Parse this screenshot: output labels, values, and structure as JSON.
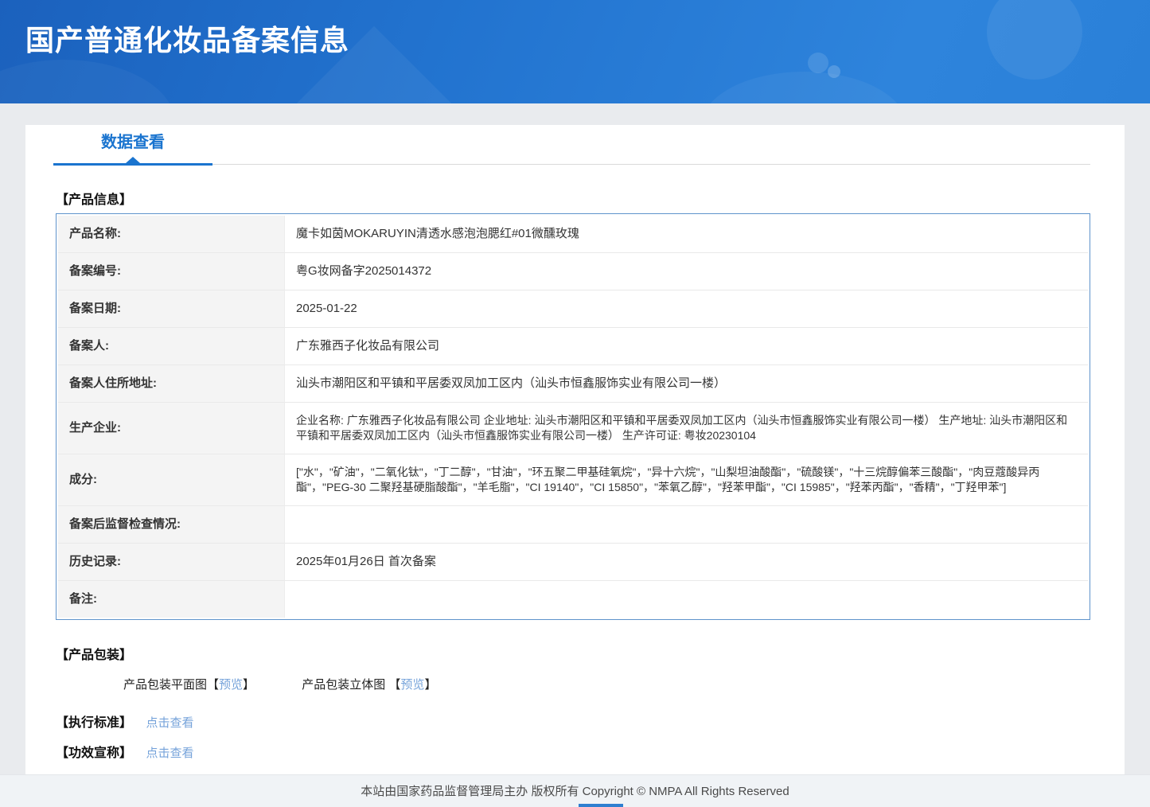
{
  "colors": {
    "accent": "#1a74cf",
    "link": "#76a3da",
    "header_gradient_start": "#1b61bd",
    "header_gradient_end": "#2e84dc",
    "table_border": "#5e93cb"
  },
  "header": {
    "title": "国产普通化妆品备案信息"
  },
  "tabs": {
    "data_view": "数据查看"
  },
  "product_info": {
    "section_title": "【产品信息】",
    "rows": [
      {
        "label": "产品名称:",
        "value": "魔卡如茵MOKARUYIN清透水感泡泡腮红#01微醺玫瑰"
      },
      {
        "label": "备案编号:",
        "value": "粤G妆网备字2025014372"
      },
      {
        "label": "备案日期:",
        "value": "2025-01-22"
      },
      {
        "label": "备案人:",
        "value": "广东雅西子化妆品有限公司"
      },
      {
        "label": "备案人住所地址:",
        "value": "汕头市潮阳区和平镇和平居委双凤加工区内（汕头市恒鑫服饰实业有限公司一楼）"
      },
      {
        "label": "生产企业:",
        "value": "企业名称: 广东雅西子化妆品有限公司 企业地址: 汕头市潮阳区和平镇和平居委双凤加工区内（汕头市恒鑫服饰实业有限公司一楼） 生产地址: 汕头市潮阳区和平镇和平居委双凤加工区内（汕头市恒鑫服饰实业有限公司一楼） 生产许可证: 粤妆20230104"
      },
      {
        "label": "成分:",
        "value": "[\"水\"，\"矿油\"，\"二氧化钛\"，\"丁二醇\"，\"甘油\"，\"环五聚二甲基硅氧烷\"，\"异十六烷\"，\"山梨坦油酸酯\"，\"硫酸镁\"，\"十三烷醇偏苯三酸酯\"，\"肉豆蔻酸异丙酯\"，\"PEG-30 二聚羟基硬脂酸酯\"，\"羊毛脂\"，\"CI 19140\"，\"CI 15850\"，\"苯氧乙醇\"，\"羟苯甲酯\"，\"CI 15985\"，\"羟苯丙酯\"，\"香精\"，\"丁羟甲苯\"]"
      },
      {
        "label": "备案后监督检查情况:",
        "value": ""
      },
      {
        "label": "历史记录:",
        "value": "2025年01月26日 首次备案"
      },
      {
        "label": "备注:",
        "value": ""
      }
    ]
  },
  "packaging": {
    "section_title": "【产品包装】",
    "items": [
      {
        "label": "产品包装平面图",
        "open": "【",
        "link": "预览",
        "close": "】"
      },
      {
        "label": "产品包装立体图 ",
        "open": "【",
        "link": "预览",
        "close": "】"
      }
    ]
  },
  "standard": {
    "section_title": "【执行标准】",
    "link": "点击查看"
  },
  "efficacy": {
    "section_title": "【功效宣称】",
    "link": "点击查看"
  },
  "footer": {
    "copyright": "本站由国家药品监督管理局主办 版权所有 Copyright © NMPA All Rights Reserved"
  }
}
